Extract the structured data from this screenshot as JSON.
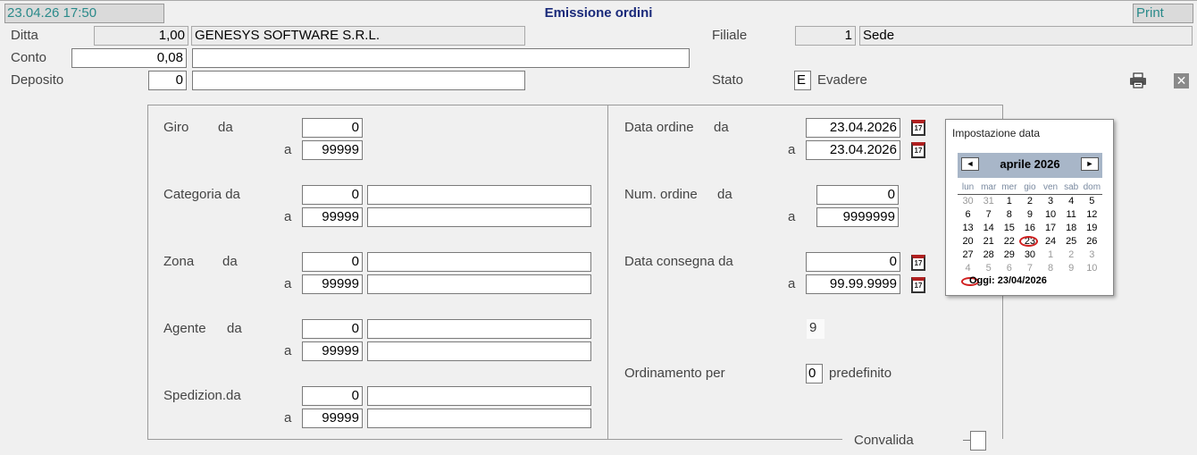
{
  "header": {
    "timestamp": "23.04.26 17:50",
    "title": "Emissione ordini",
    "print_label": "Print"
  },
  "top": {
    "ditta": {
      "label": "Ditta",
      "code": "1,00",
      "name": "GENESYS SOFTWARE S.R.L."
    },
    "conto": {
      "label": "Conto",
      "code": "0,08",
      "name": ""
    },
    "deposito": {
      "label": "Deposito",
      "code": "0",
      "name": ""
    },
    "filiale": {
      "label": "Filiale",
      "code": "1",
      "name": "Sede"
    },
    "stato": {
      "label": "Stato",
      "code": "E",
      "desc": "Evadere"
    }
  },
  "left": {
    "giro": {
      "label": "Giro",
      "da": "da",
      "a": "a",
      "from": "0",
      "to": "99999"
    },
    "categoria": {
      "label": "Categoria da",
      "a": "a",
      "from": "0",
      "to": "99999",
      "from_desc": "",
      "to_desc": ""
    },
    "zona": {
      "label": "Zona",
      "da": "da",
      "a": "a",
      "from": "0",
      "to": "99999",
      "from_desc": "",
      "to_desc": ""
    },
    "agente": {
      "label": "Agente",
      "da": "da",
      "a": "a",
      "from": "0",
      "to": "99999",
      "from_desc": "",
      "to_desc": ""
    },
    "spedizion": {
      "label": "Spedizion.da",
      "a": "a",
      "from": "0",
      "to": "99999",
      "from_desc": "",
      "to_desc": ""
    }
  },
  "right": {
    "data_ordine": {
      "label": "Data ordine",
      "da": "da",
      "a": "a",
      "from": "23.04.2026",
      "to": "23.04.2026"
    },
    "num_ordine": {
      "label": "Num. ordine",
      "da": "da",
      "a": "a",
      "from": "0",
      "to": "9999999"
    },
    "data_consegna": {
      "label": "Data consegna da",
      "a": "a",
      "from": "0",
      "to": "99.99.9999"
    },
    "misc_value": "9",
    "ordinamento": {
      "label": "Ordinamento per",
      "code": "0",
      "desc": "predefinito"
    }
  },
  "convalida_label": "Convalida",
  "calendar": {
    "title": "Impostazione data",
    "month": "aprile 2026",
    "prev": "◄",
    "next": "►",
    "weekdays": [
      "lun",
      "mar",
      "mer",
      "gio",
      "ven",
      "sab",
      "dom"
    ],
    "weeks": [
      [
        "30",
        "31",
        "1",
        "2",
        "3",
        "4",
        "5"
      ],
      [
        "6",
        "7",
        "8",
        "9",
        "10",
        "11",
        "12"
      ],
      [
        "13",
        "14",
        "15",
        "16",
        "17",
        "18",
        "19"
      ],
      [
        "20",
        "21",
        "22",
        "23",
        "24",
        "25",
        "26"
      ],
      [
        "27",
        "28",
        "29",
        "30",
        "1",
        "2",
        "3"
      ],
      [
        "4",
        "5",
        "6",
        "7",
        "8",
        "9",
        "10"
      ]
    ],
    "today_label": "Oggi: 23/04/2026",
    "calendar_icon_text": "17"
  },
  "icons": {
    "printer": "printer-icon",
    "close": "close-icon",
    "calendar": "calendar-icon"
  }
}
